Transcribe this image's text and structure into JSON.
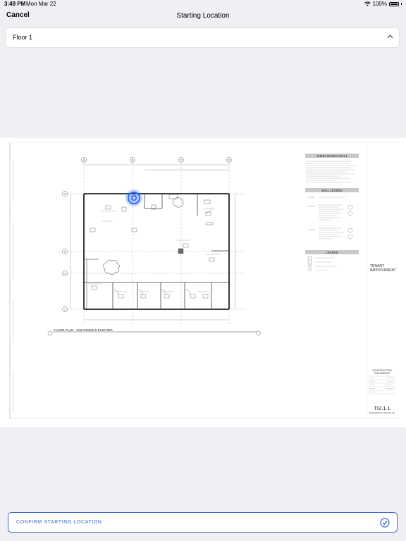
{
  "status_bar": {
    "time": "3:49 PM",
    "date": "Mon Mar 22",
    "battery": "100%"
  },
  "nav": {
    "cancel_label": "Cancel",
    "title": "Starting Location"
  },
  "floor_select": {
    "value": "Floor 1",
    "icon": "chevron-up-icon"
  },
  "plan": {
    "sheet_notes_title": "SHEET NOTES TI2.1.1",
    "wall_legend_title": "WALL LEGEND",
    "legend_title": "LEGEND",
    "plan_title": "FLOOR PLAN - ENLARGED & EXISTING",
    "project_name_line1": "TENANT",
    "project_name_line2": "IMPROVEMENT",
    "stamp_line1": "CONSTRUCTION",
    "stamp_line2": "DOCUMENTS",
    "sheet_number": "TI2.1.1",
    "sheet_name": "ENLARGED FLOOR PLAN",
    "grid_columns": [
      "A",
      "B",
      "C",
      "D"
    ],
    "grid_rows": [
      "4",
      "3",
      "2.4",
      "1"
    ]
  },
  "confirm": {
    "label": "CONFIRM STARTING LOCATION",
    "icon": "check-circle-icon"
  },
  "colors": {
    "accent": "#3a66c9",
    "location_marker": "#2f6bff"
  }
}
